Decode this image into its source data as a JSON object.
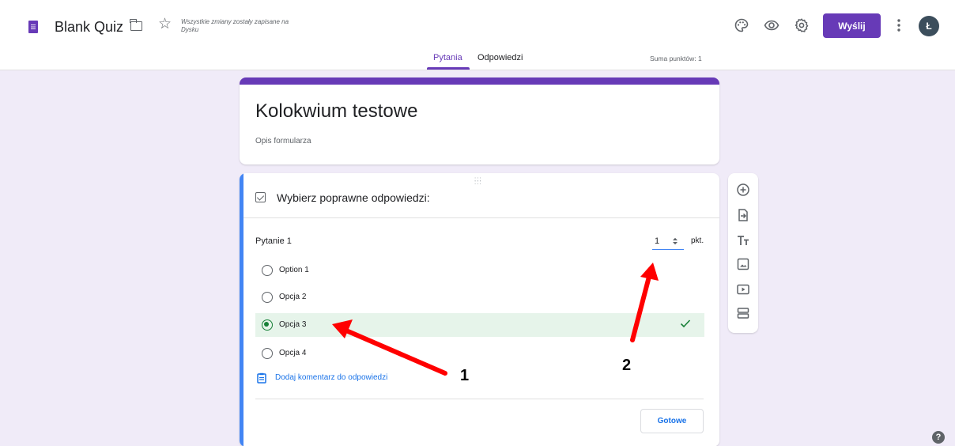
{
  "header": {
    "title": "Blank Quiz",
    "save_status": "Wszystkie zmiany zostały zapisane na Dysku",
    "send_label": "Wyślij",
    "avatar_initial": "Ł",
    "icons": [
      "forms-logo-icon",
      "folder-icon",
      "star-icon",
      "palette-icon",
      "eye-icon",
      "gear-icon",
      "more-vert-icon"
    ]
  },
  "tabs": [
    {
      "label": "Pytania",
      "active": true
    },
    {
      "label": "Odpowiedzi",
      "active": false
    }
  ],
  "points_total": "Suma punktów: 1",
  "form": {
    "title": "Kolokwium testowe",
    "description": "Opis formularza"
  },
  "question": {
    "header": "Wybierz poprawne odpowiedzi:",
    "label": "Pytanie 1",
    "points_value": "1",
    "points_unit": "pkt.",
    "options": [
      {
        "label": "Option 1",
        "selected": false
      },
      {
        "label": "Opcja 2",
        "selected": false
      },
      {
        "label": "Opcja 3",
        "selected": true
      },
      {
        "label": "Opcja 4",
        "selected": false
      }
    ],
    "feedback_link": "Dodaj komentarz do odpowiedzi",
    "done_label": "Gotowe"
  },
  "toolbar": [
    "add-question-icon",
    "import-questions-icon",
    "title-text-icon",
    "image-icon",
    "video-icon",
    "section-icon"
  ],
  "help_label": "?",
  "annotations": [
    {
      "number": "1"
    },
    {
      "number": "2"
    }
  ],
  "colors": {
    "accent": "#673ab7",
    "background": "#f0ebf8",
    "card_accent": "#4285f4",
    "correct": "#188038",
    "correct_bg": "#e6f4ea",
    "link": "#1a73e8",
    "arrow": "#ff0000"
  }
}
